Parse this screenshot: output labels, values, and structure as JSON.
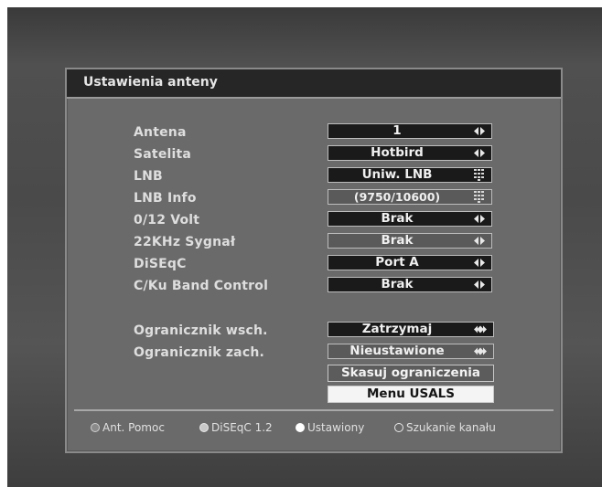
{
  "dialog": {
    "title": "Ustawienia anteny"
  },
  "settings": [
    {
      "label": "Antena",
      "value": "1",
      "control": "arrows",
      "dim": false
    },
    {
      "label": "Satelita",
      "value": "Hotbird",
      "control": "arrows",
      "dim": false
    },
    {
      "label": "LNB",
      "value": "Uniw. LNB",
      "control": "keypad",
      "dim": false
    },
    {
      "label": "LNB Info",
      "value": "(9750/10600)",
      "control": "keypad",
      "dim": true
    },
    {
      "label": "0/12 Volt",
      "value": "Brak",
      "control": "arrows",
      "dim": false
    },
    {
      "label": "22KHz Sygnał",
      "value": "Brak",
      "control": "arrows",
      "dim": true
    },
    {
      "label": "DiSEqC",
      "value": "Port A",
      "control": "arrows",
      "dim": false
    },
    {
      "label": "C/Ku Band Control",
      "value": "Brak",
      "control": "arrows",
      "dim": false
    }
  ],
  "limits": [
    {
      "label": "Ogranicznik wsch.",
      "value": "Zatrzymaj",
      "control": "double-arrows"
    },
    {
      "label": "Ogranicznik zach.",
      "value": "Nieustawione",
      "control": "double-arrows"
    }
  ],
  "actions": {
    "reset_limits": "Skasuj ograniczenia",
    "usals_menu": "Menu USALS"
  },
  "legend": [
    {
      "color": "#8a8a8a",
      "label": "Ant. Pomoc"
    },
    {
      "color": "#c8c8c8",
      "label": "DiSEqC 1.2"
    },
    {
      "color": "#ffffff",
      "label": "Ustawiony"
    },
    {
      "color": "transparent",
      "label": "Szukanie kanału"
    }
  ]
}
